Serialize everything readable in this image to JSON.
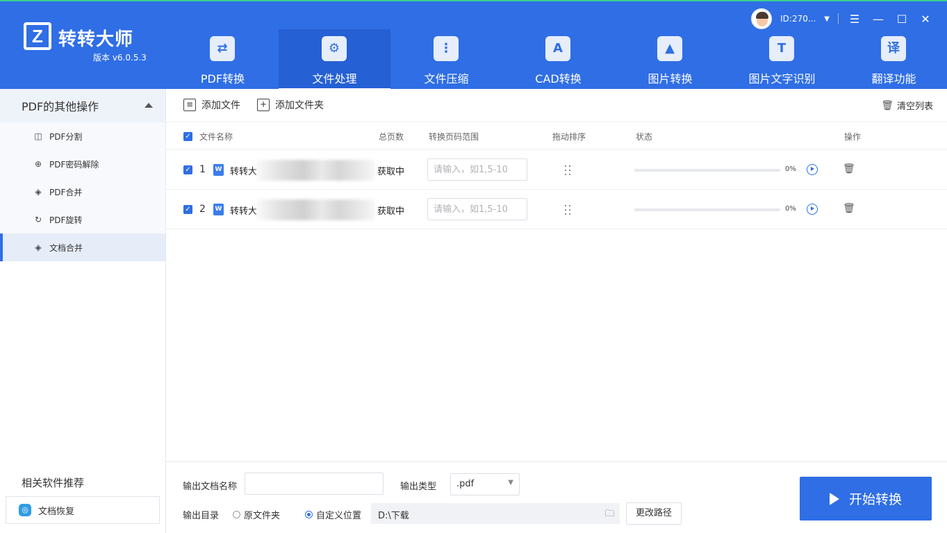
{
  "app": {
    "name": "转转大师",
    "version": "版本 v6.0.5.3",
    "logo_letter": "Z",
    "user_id": "ID:270...",
    "accent": "#2f6ee5"
  },
  "nav": [
    {
      "label": "PDF转换",
      "icon": "pdf-convert-icon",
      "glyph": "⇄"
    },
    {
      "label": "文件处理",
      "icon": "file-process-icon",
      "glyph": "⚙"
    },
    {
      "label": "文件压缩",
      "icon": "file-compress-icon",
      "glyph": "⋮"
    },
    {
      "label": "CAD转换",
      "icon": "cad-icon",
      "glyph": "A"
    },
    {
      "label": "图片转换",
      "icon": "image-convert-icon",
      "glyph": "▲"
    },
    {
      "label": "图片文字识别",
      "icon": "ocr-icon",
      "glyph": "T"
    },
    {
      "label": "翻译功能",
      "icon": "translate-icon",
      "glyph": "译"
    }
  ],
  "sidebar": {
    "section_title": "PDF的其他操作",
    "items": [
      {
        "label": "PDF分割",
        "glyph": "◫"
      },
      {
        "label": "PDF密码解除",
        "glyph": "⊕"
      },
      {
        "label": "PDF合并",
        "glyph": "◈"
      },
      {
        "label": "PDF旋转",
        "glyph": "↻"
      },
      {
        "label": "文档合并",
        "glyph": "◈"
      }
    ],
    "related_title": "相关软件推荐",
    "related_item": "文档恢复"
  },
  "toolbar": {
    "add_file": "添加文件",
    "add_folder": "添加文件夹",
    "clear_list": "清空列表"
  },
  "table": {
    "headers": {
      "name": "文件名称",
      "pages": "总页数",
      "range": "转换页码范围",
      "drag": "拖动排序",
      "status": "状态",
      "action": "操作"
    },
    "rows": [
      {
        "index": "1",
        "name": "转转大",
        "pages": "获取中",
        "range_placeholder": "请输入，如1,5-10",
        "progress": "0%",
        "progress_value": 0
      },
      {
        "index": "2",
        "name": "转转大",
        "pages": "获取中",
        "range_placeholder": "请输入，如1,5-10",
        "progress": "0%",
        "progress_value": 0
      }
    ]
  },
  "output": {
    "name_label": "输出文档名称",
    "name_value": "",
    "type_label": "输出类型",
    "type_value": ".pdf",
    "dir_label": "输出目录",
    "opt_original": "原文件夹",
    "opt_custom": "自定义位置",
    "path": "D:\\下载",
    "change_path": "更改路径",
    "start": "开始转换"
  }
}
